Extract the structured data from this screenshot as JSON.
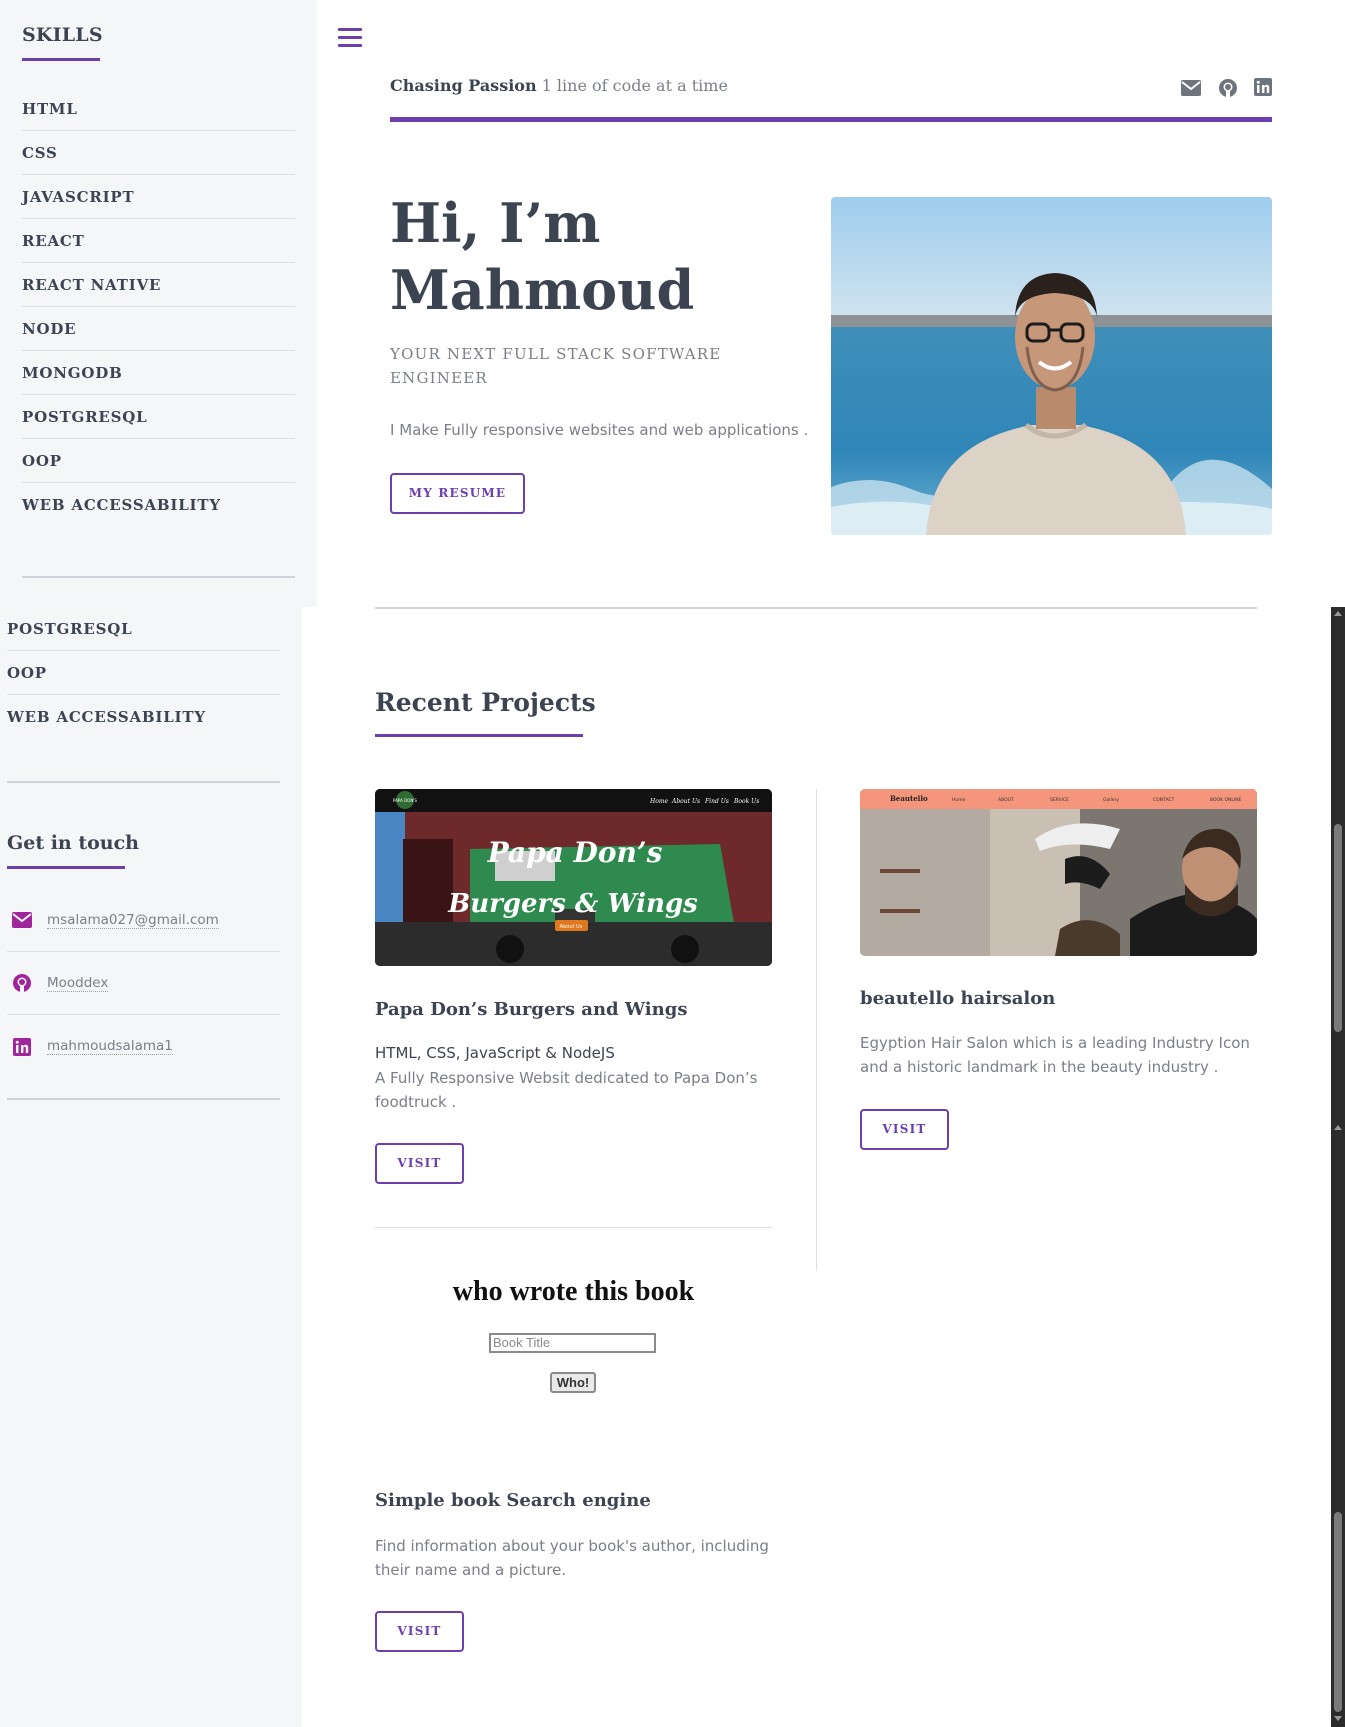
{
  "sidebar": {
    "skills_heading": "SKILLS",
    "skills": [
      "HTML",
      "CSS",
      "JAVASCRIPT",
      "REACT",
      "REACT NATIVE",
      "NODE",
      "MONGODB",
      "POSTGRESQL",
      "OOP",
      "WEB ACCESSABILITY"
    ],
    "skills_scrolled": [
      "POSTGRESQL",
      "OOP",
      "WEB ACCESSABILITY"
    ],
    "get_in_touch": "Get in touch",
    "contacts": [
      {
        "icon": "envelope-icon",
        "label": "msalama027@gmail.com"
      },
      {
        "icon": "github-icon",
        "label": "Mooddex"
      },
      {
        "icon": "linkedin-icon",
        "label": "mahmoudsalama1"
      }
    ]
  },
  "header": {
    "tagline_bold": "Chasing Passion",
    "tagline_rest": " 1 line of code at a time",
    "social_icons": [
      "envelope-icon",
      "github-icon",
      "linkedin-icon"
    ]
  },
  "hero": {
    "title_line1": "Hi, I’m",
    "title_line2": "Mahmoud",
    "subtitle": "YOUR NEXT FULL STACK SOFTWARE ENGINEER",
    "description": "I Make Fully responsive websites and web applications .",
    "resume_button": "MY RESUME"
  },
  "projects": {
    "heading": "Recent Projects",
    "items": [
      {
        "title": "Papa Don’s Burgers and Wings",
        "tech": "HTML, CSS, JavaScript & NodeJS",
        "description": "A Fully Responsive Websit dedicated to Papa Don’s foodtruck .",
        "button": "VISIT",
        "screenshot": {
          "brand_logo": "PAPA DON'S",
          "nav": [
            "Home",
            "About Us",
            "Find Us",
            "Book Us"
          ],
          "headline1": "Papa Don’s",
          "headline2": "Burgers & Wings",
          "cta": "About Us"
        }
      },
      {
        "title": "beautello hairsalon",
        "description": "Egyption Hair Salon which is a leading Industry Icon and a historic landmark in the beauty industry .",
        "button": "VISIT",
        "screenshot": {
          "brand": "Beautello",
          "nav": [
            "Home",
            "ABOUT",
            "SERVICE",
            "Gallery",
            "CONTACT",
            "BOOK ONLINE"
          ]
        }
      },
      {
        "title": "Simple book Search engine",
        "description": "Find information about your book's author, including their name and a picture.",
        "button": "VISIT",
        "screenshot": {
          "heading": "who wrote this book",
          "input_placeholder": "Book Title",
          "button": "Who!"
        }
      }
    ]
  },
  "colors": {
    "accent": "#6b3fae",
    "text_dark": "#3d4451",
    "text_muted": "#7a7f88",
    "sidebar_bg": "#f5f6f8",
    "contact_icon": "#a0259b"
  }
}
